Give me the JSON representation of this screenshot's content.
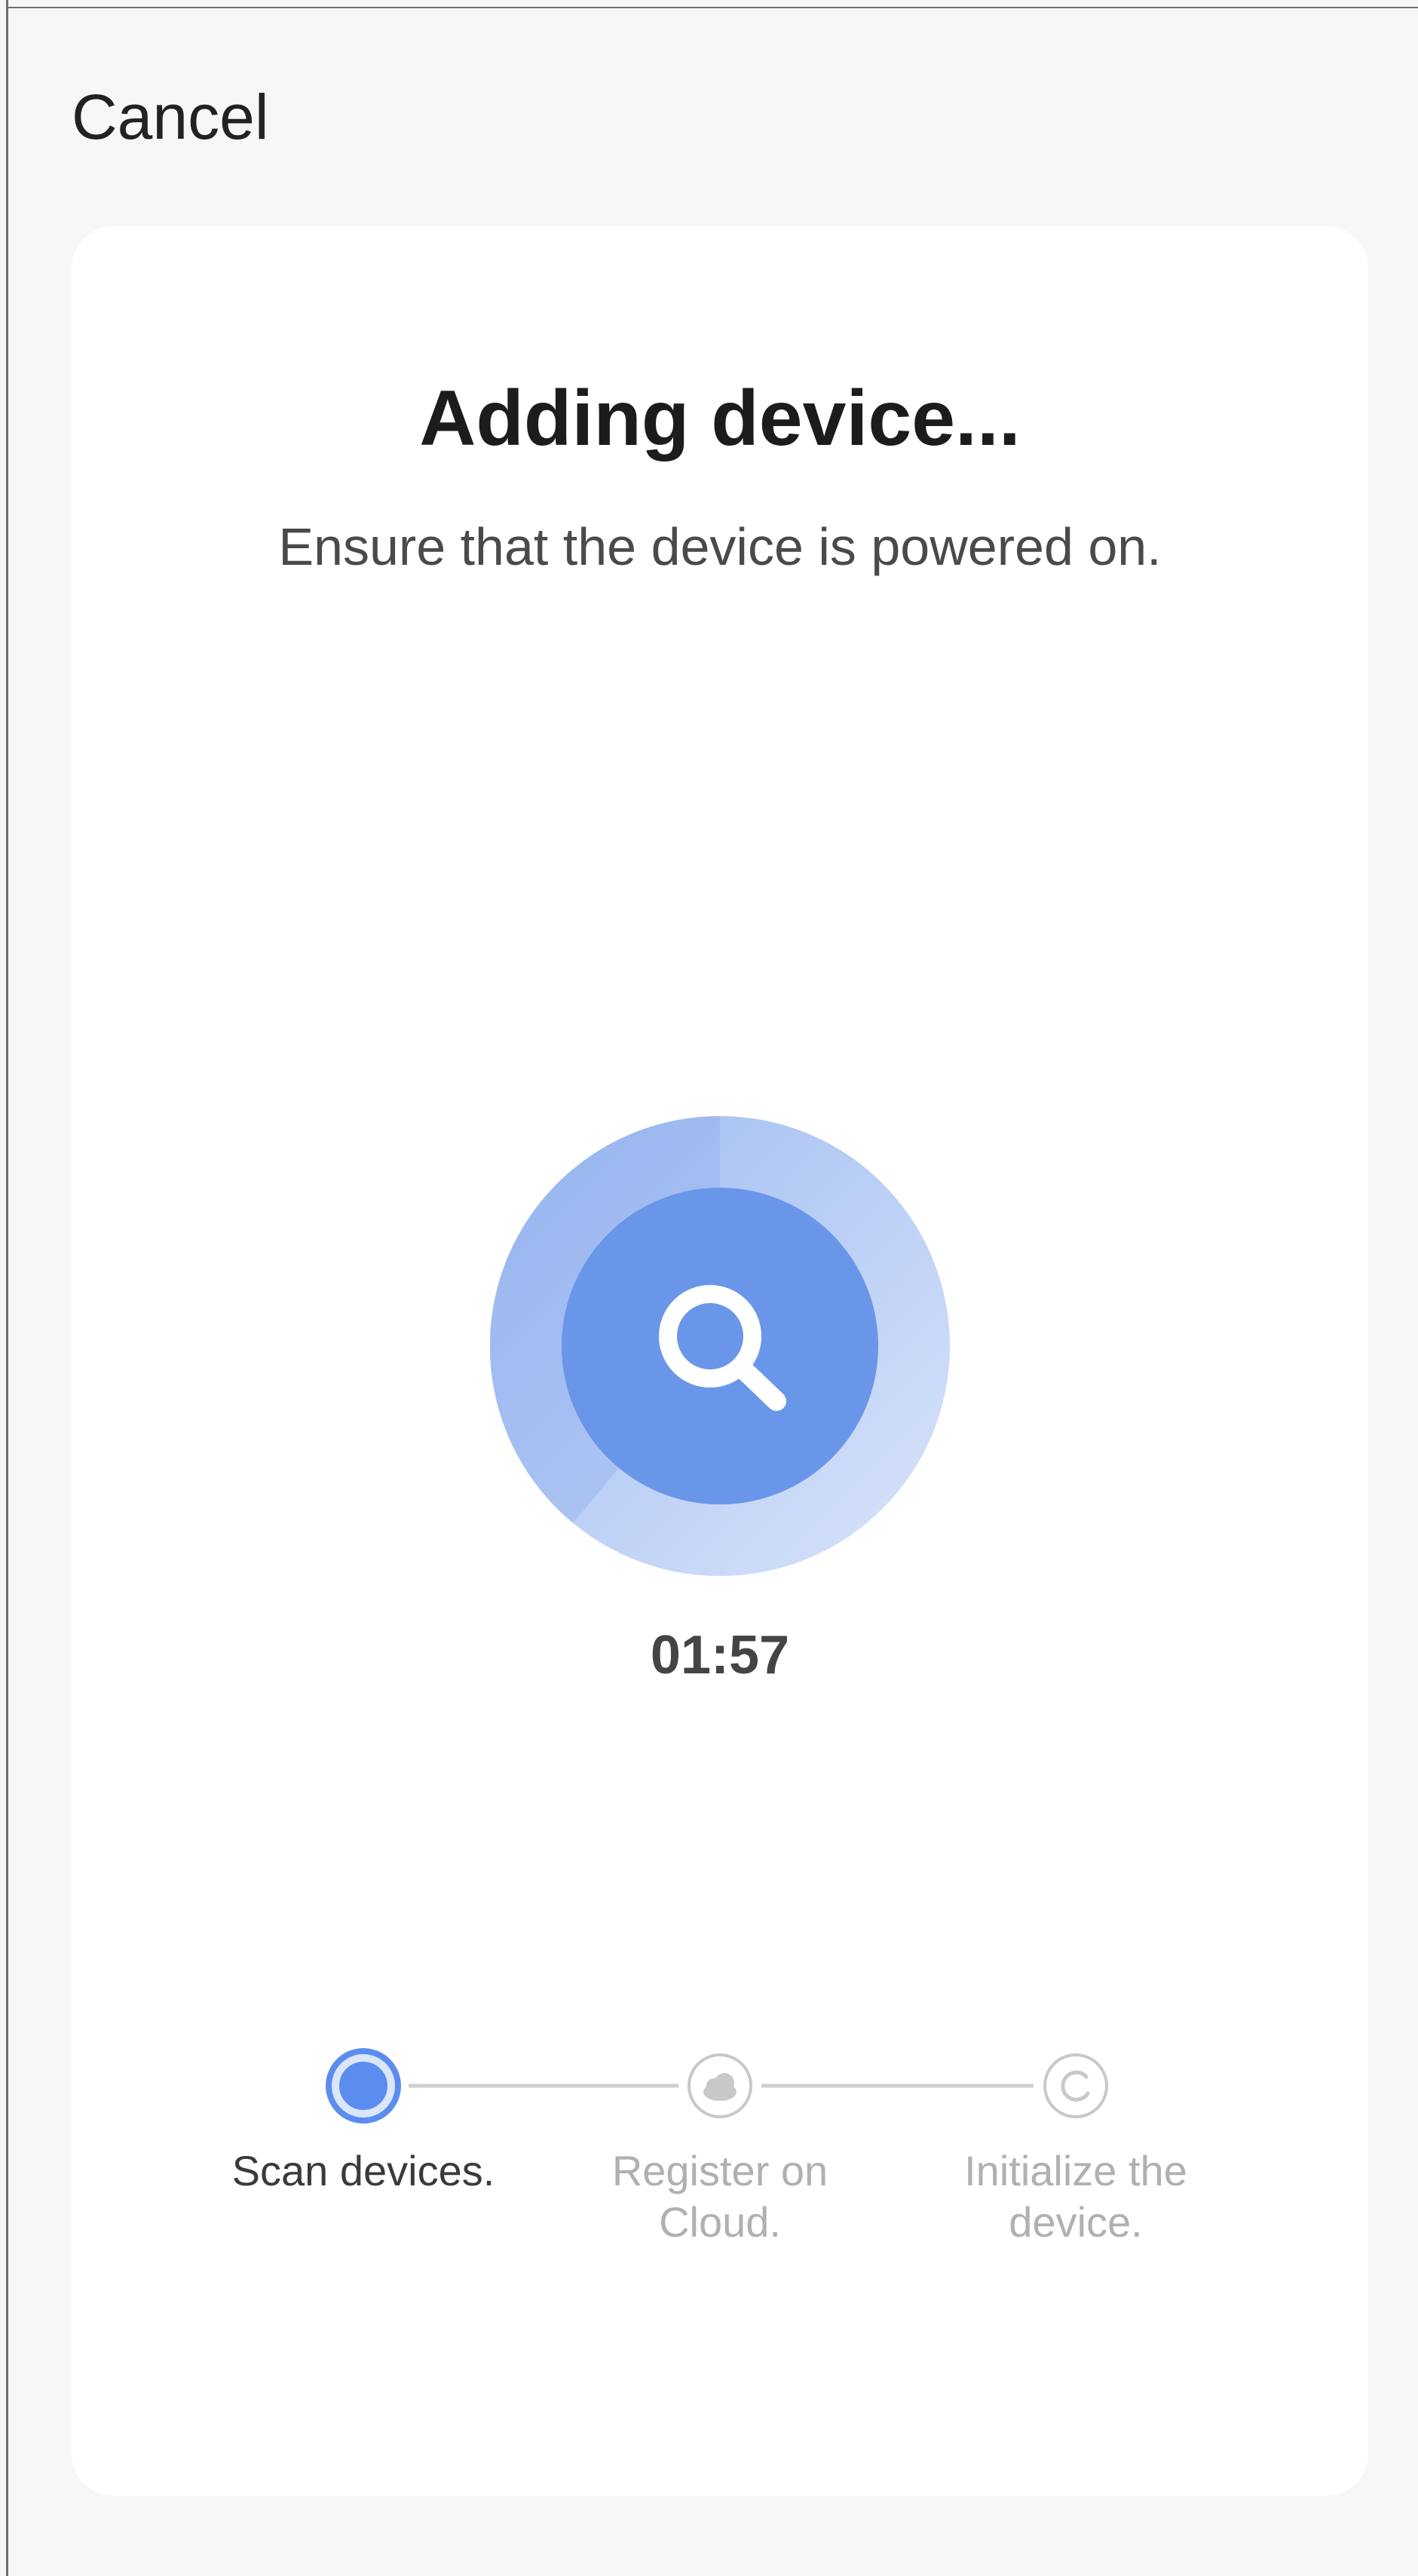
{
  "header": {
    "cancel_label": "Cancel"
  },
  "main": {
    "title": "Adding device...",
    "subtitle": "Ensure that the device is powered on.",
    "timer": "01:57"
  },
  "steps": [
    {
      "label": "Scan devices.",
      "state": "active",
      "icon": "spinner-icon"
    },
    {
      "label": "Register on Cloud.",
      "state": "pending",
      "icon": "cloud-icon"
    },
    {
      "label": "Initialize the device.",
      "state": "pending",
      "icon": "refresh-icon"
    }
  ],
  "colors": {
    "accent": "#5b8def",
    "accent_light": "#c2d3f7",
    "pending": "#bdbdbd",
    "background": "#f7f7f7",
    "card": "#ffffff"
  }
}
